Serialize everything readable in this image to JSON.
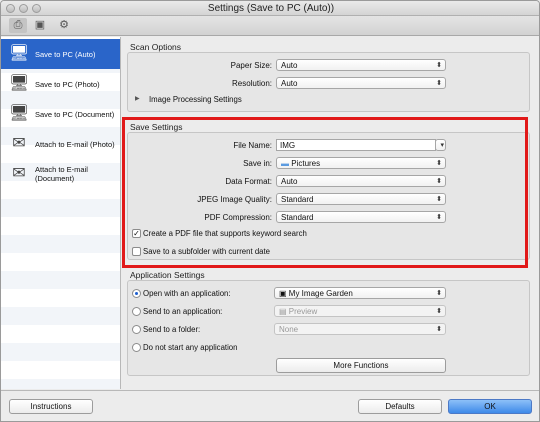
{
  "window": {
    "title": "Settings (Save to PC (Auto))"
  },
  "toolbar": {
    "icons": [
      "scan-from-computer-icon",
      "scan-from-panel-icon",
      "general-settings-icon"
    ]
  },
  "sidebar": {
    "items": [
      {
        "label": "Save to PC (Auto)",
        "selected": true
      },
      {
        "label": "Save to PC (Photo)"
      },
      {
        "label": "Save to PC (Document)"
      },
      {
        "label": "Attach to E-mail (Photo)"
      },
      {
        "label": "Attach to E-mail (Document)"
      }
    ]
  },
  "scan_options": {
    "header": "Scan Options",
    "paper_size_label": "Paper Size:",
    "paper_size_value": "Auto",
    "resolution_label": "Resolution:",
    "resolution_value": "Auto",
    "image_processing_label": "Image Processing Settings"
  },
  "save_settings": {
    "header": "Save Settings",
    "file_name_label": "File Name:",
    "file_name_value": "IMG",
    "save_in_label": "Save in:",
    "save_in_value": "Pictures",
    "data_format_label": "Data Format:",
    "data_format_value": "Auto",
    "jpeg_quality_label": "JPEG Image Quality:",
    "jpeg_quality_value": "Standard",
    "pdf_compression_label": "PDF Compression:",
    "pdf_compression_value": "Standard",
    "keyword_pdf_label": "Create a PDF file that supports keyword search",
    "keyword_pdf_checked": true,
    "subfolder_label": "Save to a subfolder with current date",
    "subfolder_checked": false
  },
  "app_settings": {
    "header": "Application Settings",
    "open_app_label": "Open with an application:",
    "open_app_value": "My Image Garden",
    "send_app_label": "Send to an application:",
    "send_app_value": "Preview",
    "send_folder_label": "Send to a folder:",
    "send_folder_value": "None",
    "no_app_label": "Do not start any application",
    "more_functions_label": "More Functions",
    "selected_option": "open_app"
  },
  "bottom": {
    "instructions_label": "Instructions",
    "defaults_label": "Defaults",
    "ok_label": "OK"
  },
  "colors": {
    "accent": "#2a65c9",
    "highlight_box": "#e11919"
  }
}
